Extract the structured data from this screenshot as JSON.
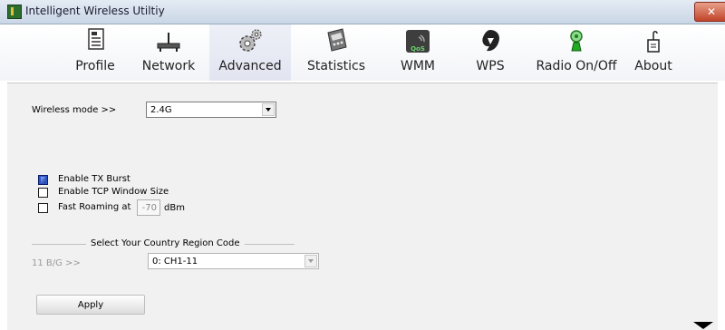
{
  "window": {
    "title": "Intelligent Wireless Utiltiy",
    "close_label": "✕"
  },
  "toolbar": {
    "items": [
      {
        "label": "Profile",
        "icon": "profile-icon"
      },
      {
        "label": "Network",
        "icon": "network-icon"
      },
      {
        "label": "Advanced",
        "icon": "advanced-icon",
        "active": true
      },
      {
        "label": "Statistics",
        "icon": "statistics-icon"
      },
      {
        "label": "WMM",
        "icon": "wmm-icon"
      },
      {
        "label": "WPS",
        "icon": "wps-icon"
      },
      {
        "label": "Radio On/Off",
        "icon": "radio-icon"
      },
      {
        "label": "About",
        "icon": "about-icon"
      }
    ],
    "wmm_icon_text": "QoS"
  },
  "advanced": {
    "wireless_mode_label": "Wireless mode >>",
    "wireless_mode_value": "2.4G",
    "tx_burst_label": "Enable TX Burst",
    "tx_burst_checked": true,
    "tcp_window_label": "Enable TCP Window Size",
    "tcp_window_checked": false,
    "fast_roaming_label": "Fast Roaming at",
    "fast_roaming_checked": false,
    "fast_roaming_value": "-70",
    "fast_roaming_unit": "dBm",
    "country_region_heading": "Select Your Country Region Code",
    "band_label": "11 B/G >>",
    "country_region_value": "0: CH1-11",
    "apply_label": "Apply"
  }
}
